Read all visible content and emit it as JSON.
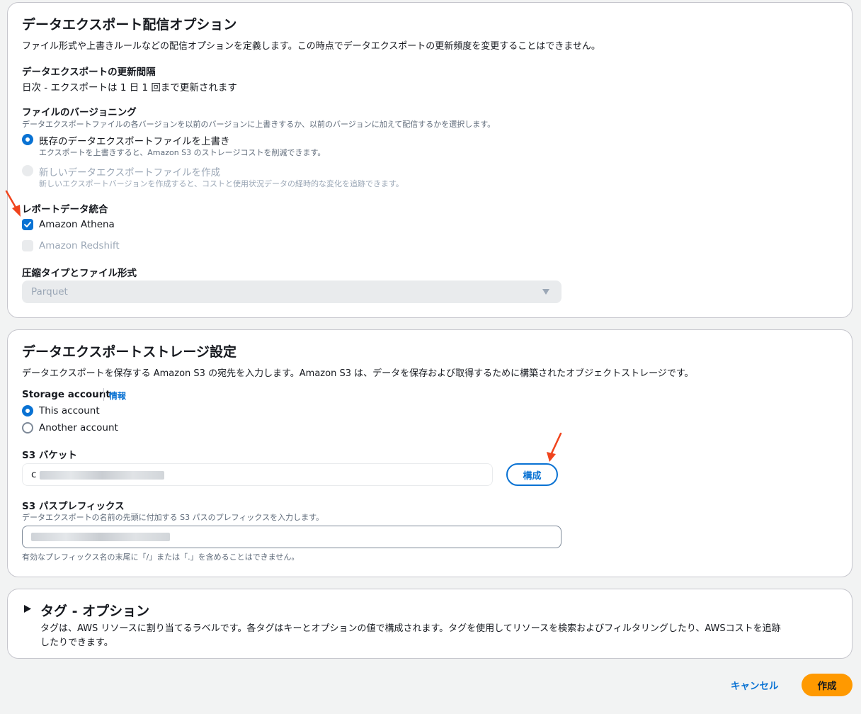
{
  "delivery": {
    "title": "データエクスポート配信オプション",
    "description": "ファイル形式や上書きルールなどの配信オプションを定義します。この時点でデータエクスポートの更新頻度を変更することはできません。",
    "frequency_label": "データエクスポートの更新間隔",
    "frequency_value": "日次 - エクスポートは 1 日 1 回まで更新されます",
    "versioning_label": "ファイルのバージョニング",
    "versioning_desc": "データエクスポートファイルの各バージョンを以前のバージョンに上書きするか、以前のバージョンに加えて配信するかを選択します。",
    "versioning_options": [
      {
        "label": "既存のデータエクスポートファイルを上書き",
        "desc": "エクスポートを上書きすると、Amazon S3 のストレージコストを削減できます。",
        "selected": true,
        "disabled": false
      },
      {
        "label": "新しいデータエクスポートファイルを作成",
        "desc": "新しいエクスポートバージョンを作成すると、コストと使用状況データの経時的な変化を追跡できます。",
        "selected": false,
        "disabled": true
      }
    ],
    "integration_label": "レポートデータ統合",
    "integration_options": [
      {
        "label": "Amazon Athena",
        "checked": true,
        "disabled": false
      },
      {
        "label": "Amazon Redshift",
        "checked": false,
        "disabled": true
      }
    ],
    "compression_label": "圧縮タイプとファイル形式",
    "compression_value": "Parquet"
  },
  "storage": {
    "title": "データエクスポートストレージ設定",
    "description": "データエクスポートを保存する Amazon S3 の宛先を入力します。Amazon S3 は、データを保存および取得するために構築されたオブジェクトストレージです。",
    "account_label": "Storage account",
    "info_link": "情報",
    "account_options": [
      {
        "label": "This account",
        "selected": true
      },
      {
        "label": "Another account",
        "selected": false
      }
    ],
    "bucket_label": "S3 バケット",
    "bucket_value_prefix": "c",
    "configure_button": "構成",
    "prefix_label": "S3 パスプレフィックス",
    "prefix_desc": "データエクスポートの名前の先頭に付加する S3 パスのプレフィックスを入力します。",
    "prefix_hint": "有効なプレフィックス名の末尾に「/」または「.」を含めることはできません。"
  },
  "tags": {
    "title": "タグ - オプション",
    "description_line1": "タグは、AWS リソースに割り当てるラベルです。各タグはキーとオプションの値で構成されます。タグを使用してリソースを検索およびフィルタリングしたり、AWSコストを追跡",
    "description_line2": "したりできます。"
  },
  "footer": {
    "cancel": "キャンセル",
    "create": "作成"
  },
  "colors": {
    "primary": "#0972d3",
    "accent": "#ff9900",
    "annotation_arrow": "#f0441d"
  }
}
